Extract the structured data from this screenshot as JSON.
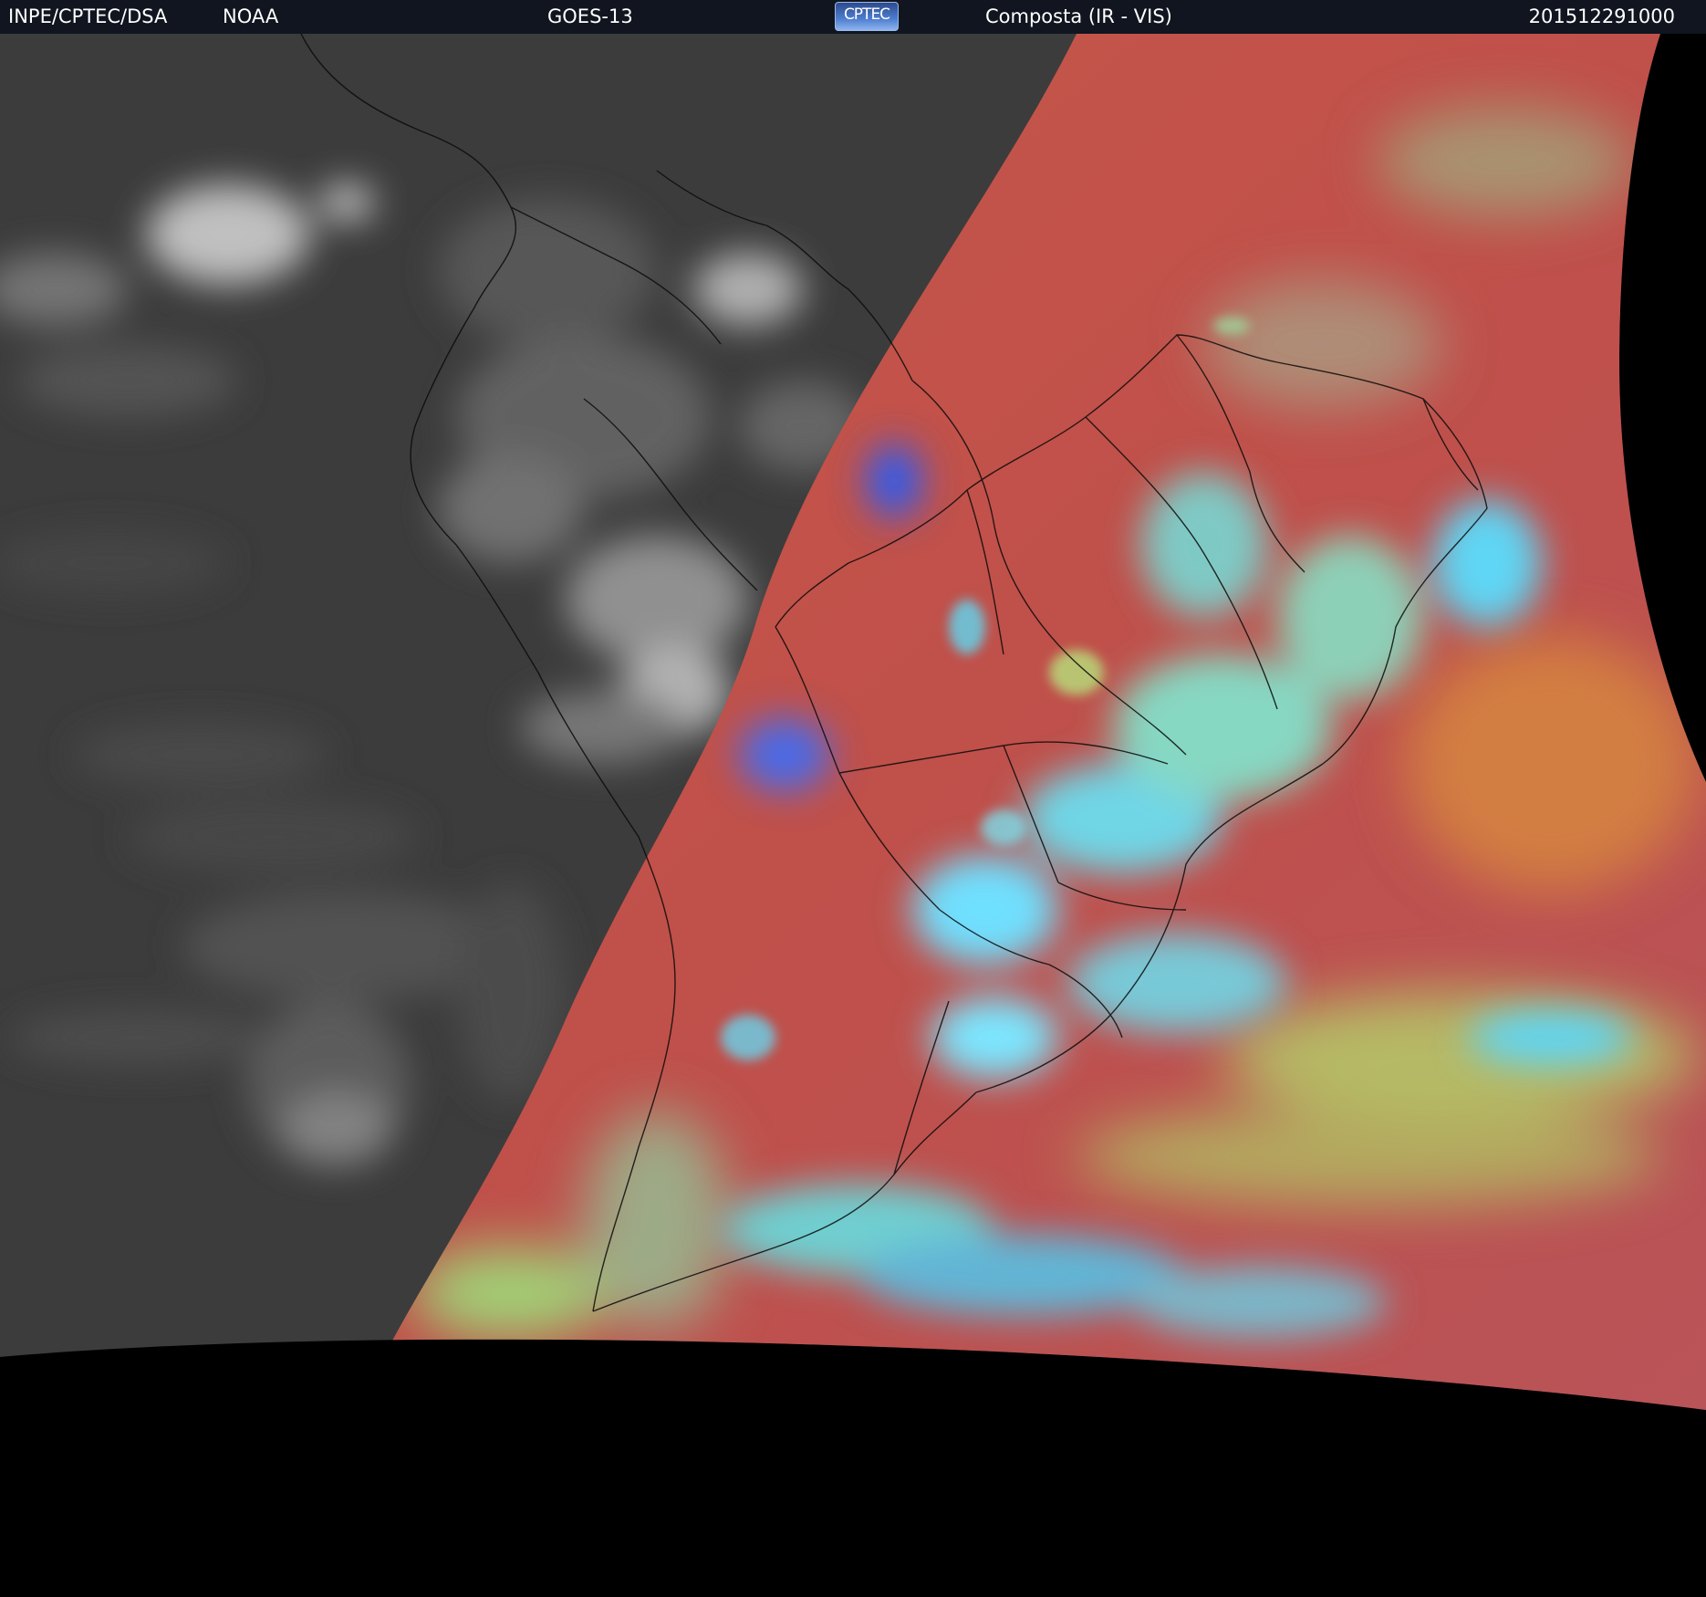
{
  "header": {
    "organization": "INPE/CPTEC/DSA",
    "agency": "NOAA",
    "satellite": "GOES-13",
    "logo_text": "CPTEC",
    "product": "Composta (IR - VIS)",
    "timestamp": "201512291000"
  },
  "colors": {
    "header_bg": "#10151f",
    "night_ir": "#3c3c3c",
    "day_composite_red": "#c0504a",
    "cloud_cyan": "#5fd6f5",
    "cloud_green": "#9be07a",
    "space_black": "#000000"
  }
}
